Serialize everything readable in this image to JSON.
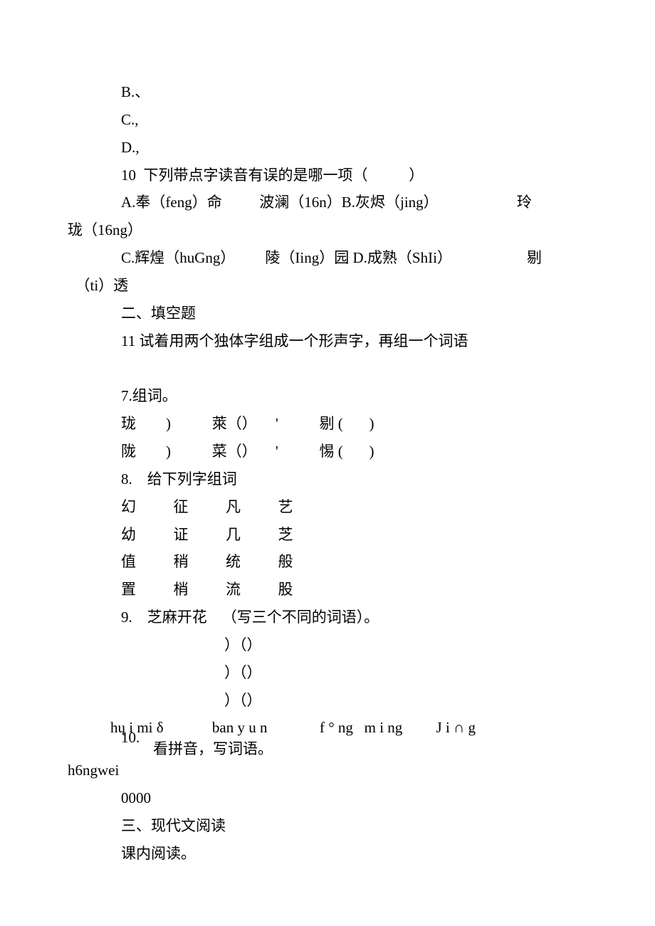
{
  "optB": "B.、",
  "optC": "C.,",
  "optD": "D.,",
  "q10_stem": "10  下列带点字读音有误的是哪一项（           ）",
  "q10_A": "A.奉（feng）命          波澜（16n）B.灰烬（jing）                     玲",
  "q10_tail1": "珑（16ng）",
  "q10_C": "C.辉煌（huGng）        陵（Iing）园 D.成熟（ShIi）                    剔",
  "q10_tail2": "  （ti）透",
  "sec2": "二、填空题",
  "q11": "11  试着用两个独体字组成一个形声字，再组一个词语",
  "q7_title": "7.组词。",
  "q7_r1": "珑        )           萊（）     '           剔 (       )",
  "q7_r2": "陇        )           菜（）     '           惕 (       )",
  "q8_title": "8.    给下列字组词",
  "q8_r1": "幻          征          凡          艺",
  "q8_r2": "幼          证          几          芝",
  "q8_r3": "值          稍          统          般",
  "q8_r4": "置          梢          流          股",
  "q9_title": "9.    芝麻开花    （写三个不同的词语）。",
  "q9_b1": "）（）",
  "q9_b2": "）（）",
  "q9_b3": "）（）",
  "pinyin_line": "hų i mi δ             ban y u n              f ° ng   m i ng         J i ∩ g",
  "p10_num": "10.",
  "p10_txt": "看拼音，写词语。",
  "hongwei": "h6ngwei",
  "zeros": "0000",
  "sec3": "三、现代文阅读",
  "kewen": "课内阅读。"
}
